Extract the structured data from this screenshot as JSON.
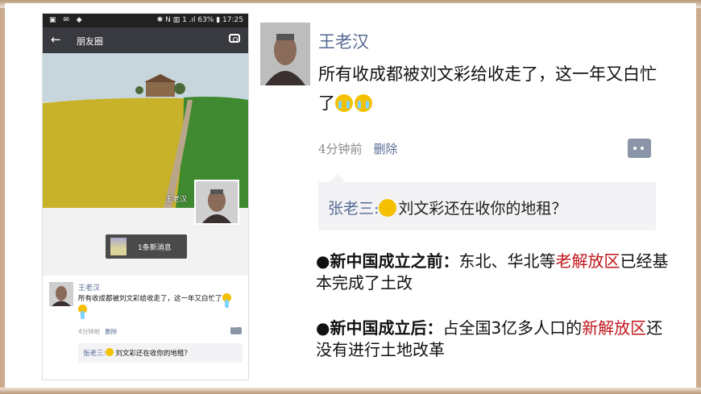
{
  "phone": {
    "status": {
      "left_icons": "▣ ✉ ◆",
      "right": "✱ N ▥ 1 .ıl 63% ▮ 17:25"
    },
    "nav": {
      "back_icon": "arrow-left",
      "title": "朋友圈",
      "camera_icon": "camera"
    },
    "cover_name": "王老汉",
    "notice": "1条新消息",
    "post": {
      "name": "王老汉",
      "text": "所有收成都被刘文彩给收走了，这一年又白忙了",
      "time": "4分钟前",
      "delete": "删除",
      "comment_name": "张老三:",
      "comment_text": "刘文彩还在收你的地租？"
    }
  },
  "zoom": {
    "name": "王老汉",
    "text": "所有收成都被刘文彩给收走了，这一年又白忙了",
    "time": "4分钟前",
    "delete": "删除",
    "comment_name": "张老三:",
    "comment_text": "刘文彩还在收你的地租？"
  },
  "bullets": {
    "b1_head": "新中国成立之前：",
    "b1_a": "东北、华北等",
    "b1_red": "老解放区",
    "b1_b": "已经基本完成了土改",
    "b2_head": "新中国成立后：",
    "b2_a": "占全国3亿多人口的",
    "b2_red": "新解放区",
    "b2_b": "还没有进行土地改革"
  },
  "colors": {
    "link_blue": "#576b95",
    "highlight_red": "#c0161c",
    "nav_dark": "#393a3f"
  }
}
